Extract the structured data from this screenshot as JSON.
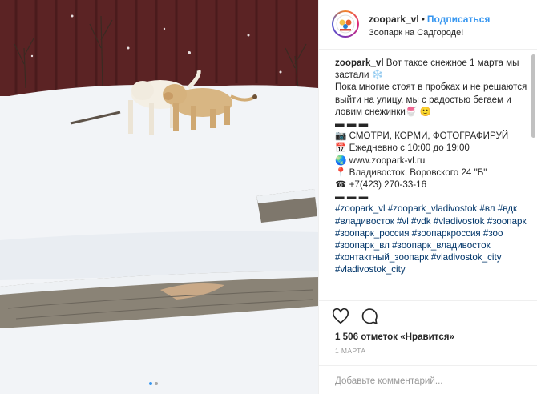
{
  "media": {
    "alt_icon": "photo-with-lion-cubs-in-snow"
  },
  "header": {
    "username": "zoopark_vl",
    "separator": "•",
    "follow_label": "Подписаться",
    "location": "Зоопарк на Садгороде!"
  },
  "caption": {
    "username": "zoopark_vl",
    "line1": " Вот такое снежное 1 марта мы застали ❄️",
    "line2": "Пока многие стоят в пробках и не решаются выйти на улицу, мы с радостью бегаем и ловим снежинки🍧 🙂",
    "sep1": "▬ ▬ ▬",
    "info1": "📷 СМОТРИ, КОРМИ, ФОТОГРАФИРУЙ",
    "info2": "📅 Ежедневно с 10:00 до 19:00",
    "info3": "🌏 www.zoopark-vl.ru",
    "info4": "📍 Владивосток, Воровского 24 \"Б\"",
    "info5": "☎ +7(423) 270-33-16",
    "sep2": "▬ ▬ ▬",
    "tags": "#zoopark_vl #zoopark_vladivostok #вл #вдк #владивосток #vl #vdk #vladivostok #зоопарк #зоопарк_россия #зоопаркроссия #зоо #зоопарк_вл #зоопарк_владивосток #контактный_зоопарк #vladivostok_city #vladivostok_city"
  },
  "actions": {
    "likes_text": "1 506 отметок «Нравится»",
    "date": "1 МАРТА"
  },
  "comment": {
    "placeholder": "Добавьте комментарий..."
  },
  "colors": {
    "link": "#3897f0",
    "tag": "#003569",
    "muted": "#999999"
  }
}
